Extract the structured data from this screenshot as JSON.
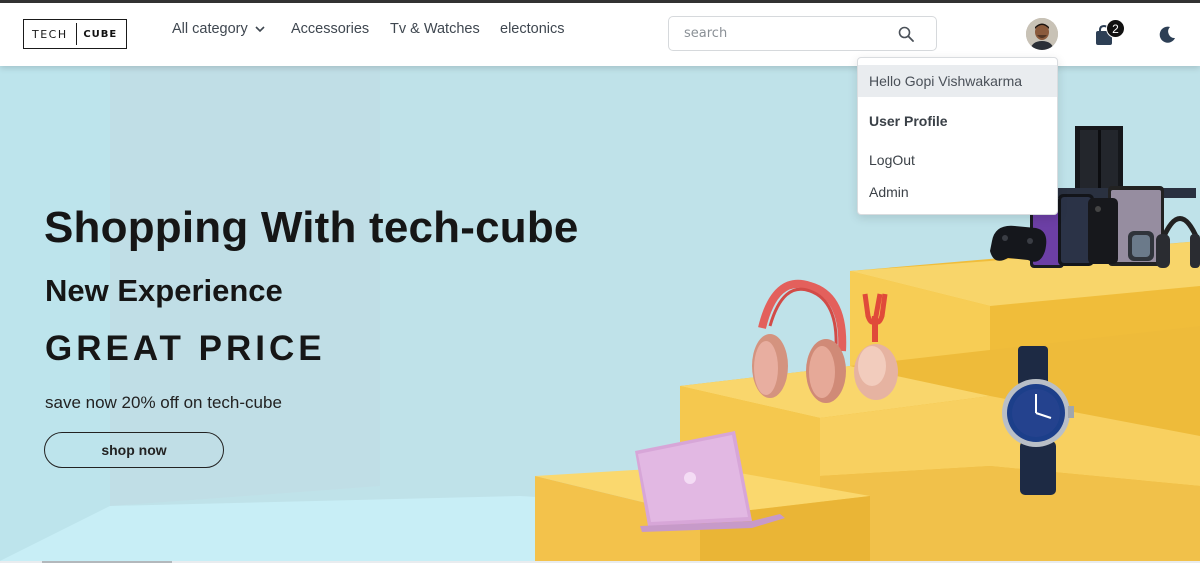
{
  "brand": {
    "logo_left": "TECH",
    "logo_right": "CUBE"
  },
  "nav": {
    "links": [
      {
        "label": "All category",
        "has_dropdown": true
      },
      {
        "label": "Accessories"
      },
      {
        "label": "Tv & Watches"
      },
      {
        "label": "electonics"
      }
    ]
  },
  "search": {
    "placeholder": "search",
    "value": ""
  },
  "cart": {
    "count": "2"
  },
  "icons": {
    "search": "search-icon",
    "cart": "shopping-bag-icon",
    "theme": "moon-icon",
    "dropdown": "chevron-down-icon"
  },
  "user_menu": {
    "greeting": "Hello Gopi Vishwakarma",
    "items": [
      "User Profile",
      "LogOut",
      "Admin"
    ]
  },
  "hero": {
    "title": "Shopping With tech-cube",
    "subtitle": "New Experience",
    "tagline": "GREAT PRICE",
    "offer": "save now 20% off on tech-cube",
    "cta": "shop now"
  },
  "colors": {
    "hero_bg": "#c3ebf3",
    "steps": "#f6c84c",
    "text": "#161616"
  }
}
